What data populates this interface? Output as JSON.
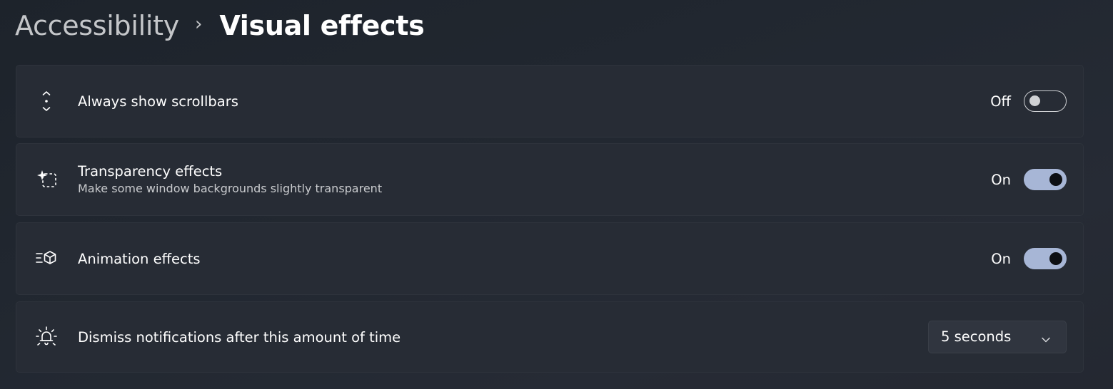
{
  "breadcrumb": {
    "parent": "Accessibility",
    "separator": "›",
    "current": "Visual effects"
  },
  "settings": [
    {
      "title": "Always show scrollbars",
      "description": "",
      "icon": "scrollbar-arrows-icon",
      "control": "toggle",
      "state_label": "Off",
      "is_on": false
    },
    {
      "title": "Transparency effects",
      "description": "Make some window backgrounds slightly transparent",
      "icon": "transparency-sparkle-icon",
      "control": "toggle",
      "state_label": "On",
      "is_on": true
    },
    {
      "title": "Animation effects",
      "description": "",
      "icon": "animation-cube-icon",
      "control": "toggle",
      "state_label": "On",
      "is_on": true
    },
    {
      "title": "Dismiss notifications after this amount of time",
      "description": "",
      "icon": "notification-bell-icon",
      "control": "dropdown",
      "selected_value": "5 seconds"
    }
  ],
  "colors": {
    "toggle_on": "#a7b6d6",
    "card_background": "#272c35",
    "page_background": "#20252d"
  }
}
